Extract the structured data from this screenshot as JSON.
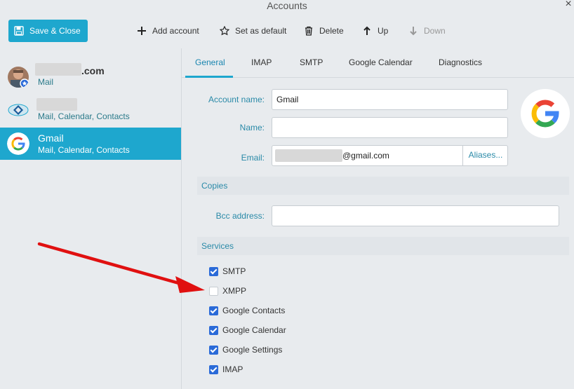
{
  "window": {
    "title": "Accounts",
    "close_glyph": "×"
  },
  "toolbar": {
    "save_label": "Save & Close",
    "add_label": "Add account",
    "default_label": "Set as default",
    "delete_label": "Delete",
    "up_label": "Up",
    "down_label": "Down"
  },
  "accounts": [
    {
      "name_suffix": ".com",
      "services": "Mail"
    },
    {
      "services": "Mail, Calendar, Contacts"
    },
    {
      "name": "Gmail",
      "services": "Mail, Calendar, Contacts"
    }
  ],
  "tabs": [
    "General",
    "IMAP",
    "SMTP",
    "Google Calendar",
    "Diagnostics"
  ],
  "form": {
    "account_name_label": "Account name:",
    "account_name_value": "Gmail",
    "name_label": "Name:",
    "name_value": "",
    "email_label": "Email:",
    "email_suffix": "@gmail.com",
    "aliases_label": "Aliases...",
    "copies_header": "Copies",
    "bcc_label": "Bcc address:",
    "bcc_value": "",
    "services_header": "Services"
  },
  "services": [
    {
      "label": "SMTP",
      "checked": true
    },
    {
      "label": "XMPP",
      "checked": false
    },
    {
      "label": "Google Contacts",
      "checked": true
    },
    {
      "label": "Google Calendar",
      "checked": true
    },
    {
      "label": "Google Settings",
      "checked": true
    },
    {
      "label": "IMAP",
      "checked": true
    }
  ],
  "colors": {
    "accent": "#1ea7ce",
    "checkbox": "#2a6ad8",
    "annotation_arrow": "#e01010"
  }
}
